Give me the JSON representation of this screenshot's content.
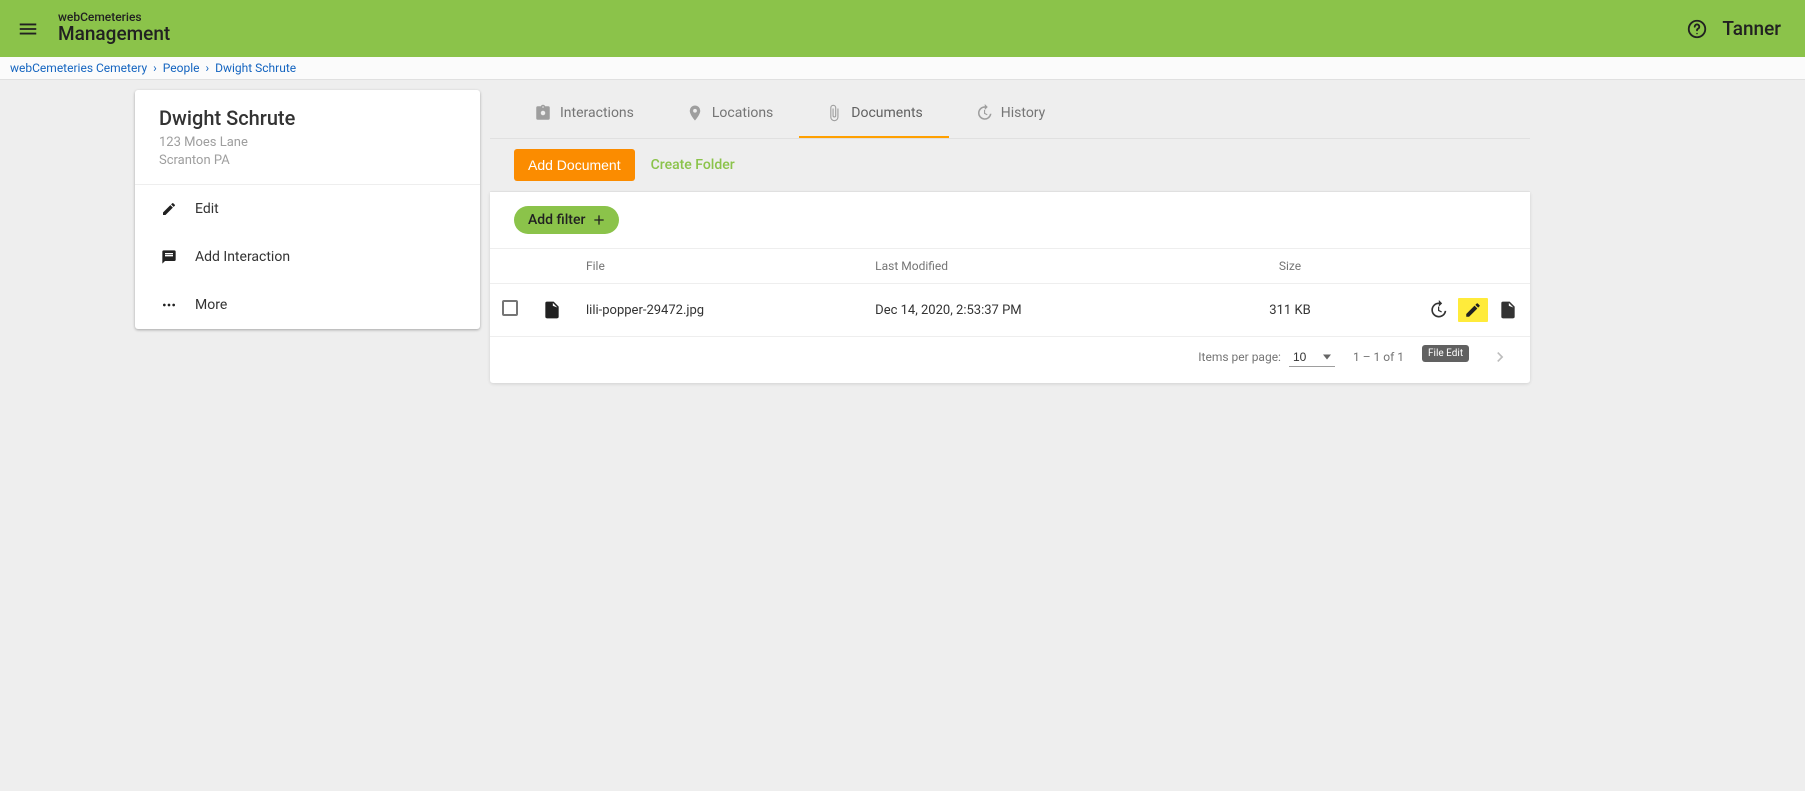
{
  "header": {
    "subtitle": "webCemeteries",
    "title": "Management",
    "user": "Tanner"
  },
  "breadcrumb": {
    "items": [
      "webCemeteries Cemetery",
      "People",
      "Dwight Schrute"
    ]
  },
  "person": {
    "name": "Dwight Schrute",
    "address_line1": "123 Moes Lane",
    "address_line2": "Scranton PA",
    "actions": {
      "edit": "Edit",
      "add_interaction": "Add Interaction",
      "more": "More"
    }
  },
  "tabs": {
    "interactions": "Interactions",
    "locations": "Locations",
    "documents": "Documents",
    "history": "History"
  },
  "toolbar": {
    "add_document": "Add Document",
    "create_folder": "Create Folder"
  },
  "filter": {
    "add_filter": "Add filter"
  },
  "table": {
    "columns": {
      "file": "File",
      "last_modified": "Last Modified",
      "size": "Size"
    },
    "rows": [
      {
        "file": "lili-popper-29472.jpg",
        "last_modified": "Dec 14, 2020, 2:53:37 PM",
        "size": "311 KB"
      }
    ]
  },
  "pagination": {
    "items_per_page_label": "Items per page:",
    "per_page": "10",
    "range": "1 – 1 of 1"
  },
  "tooltip": {
    "file_edit": "File Edit"
  }
}
